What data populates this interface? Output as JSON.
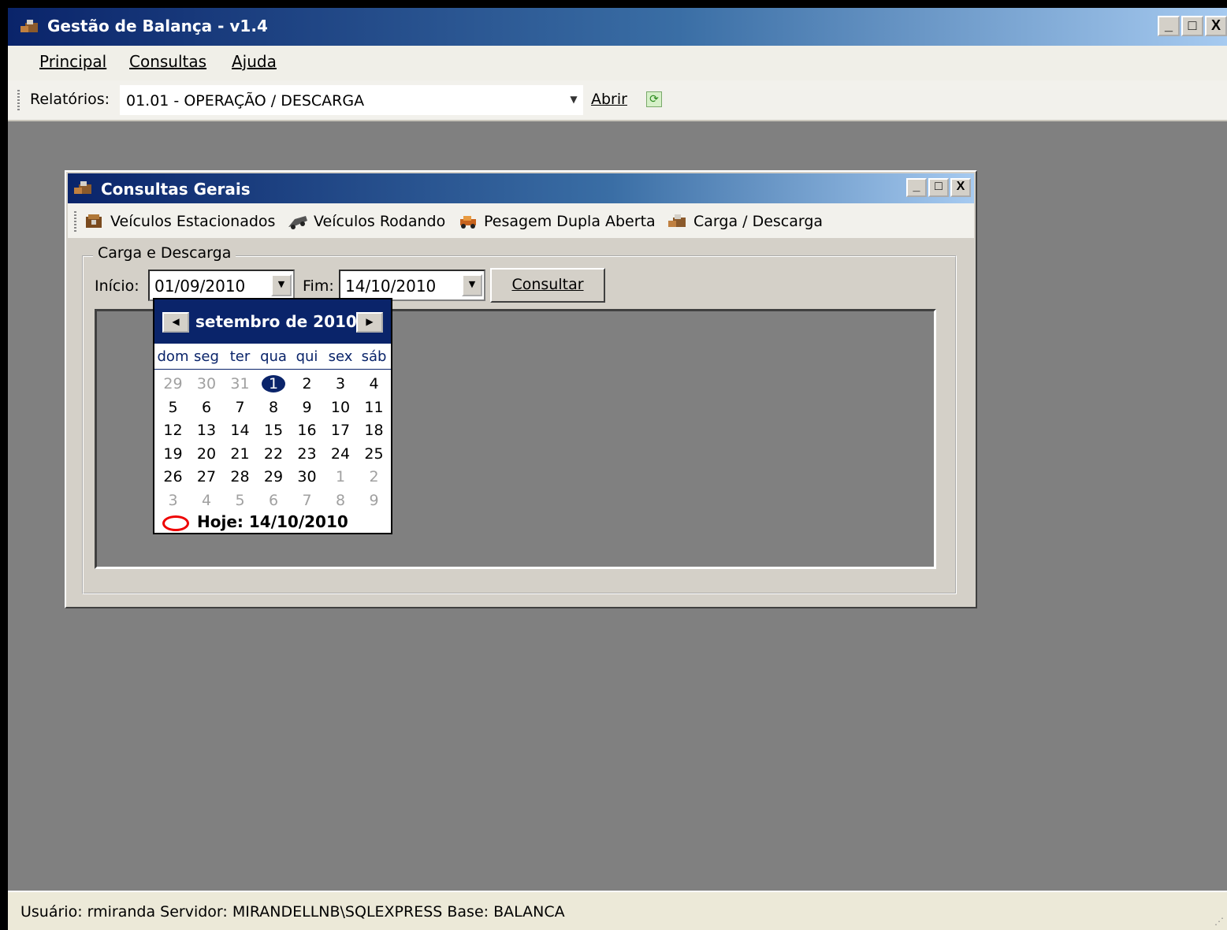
{
  "window": {
    "title": "Gestão de Balança - v1.4",
    "controls": {
      "minimize": "_",
      "maximize": "□",
      "close": "X"
    }
  },
  "menu": {
    "items": [
      {
        "label": "Principal"
      },
      {
        "label": "Consultas"
      },
      {
        "label": "Ajuda"
      }
    ]
  },
  "toolbar": {
    "reports_label": "Relatórios:",
    "report_selected": "01.01 - OPERAÇÃO / DESCARGA",
    "open_label": "Abrir",
    "refresh_icon": "refresh-icon"
  },
  "child_window": {
    "title": "Consultas Gerais",
    "controls": {
      "minimize": "_",
      "maximize": "□",
      "close": "X"
    },
    "toolbar_items": [
      {
        "label": "Veículos Estacionados",
        "icon": "parked-vehicles-icon"
      },
      {
        "label": "Veículos Rodando",
        "icon": "running-vehicles-icon"
      },
      {
        "label": "Pesagem Dupla Aberta",
        "icon": "double-weighing-icon"
      },
      {
        "label": "Carga / Descarga",
        "icon": "load-unload-icon"
      }
    ]
  },
  "filter": {
    "group_title": "Carga e Descarga",
    "start_label": "Início:",
    "start_value": "01/09/2010",
    "end_label": "Fim:",
    "end_value": "14/10/2010",
    "query_button": "Consultar"
  },
  "calendar": {
    "month_label": "setembro de 2010",
    "weekdays": [
      "dom",
      "seg",
      "ter",
      "qua",
      "qui",
      "sex",
      "sáb"
    ],
    "weeks": [
      [
        "29",
        "30",
        "31",
        "1",
        "2",
        "3",
        "4"
      ],
      [
        "5",
        "6",
        "7",
        "8",
        "9",
        "10",
        "11"
      ],
      [
        "12",
        "13",
        "14",
        "15",
        "16",
        "17",
        "18"
      ],
      [
        "19",
        "20",
        "21",
        "22",
        "23",
        "24",
        "25"
      ],
      [
        "26",
        "27",
        "28",
        "29",
        "30",
        "1",
        "2"
      ],
      [
        "3",
        "4",
        "5",
        "6",
        "7",
        "8",
        "9"
      ]
    ],
    "selected_day": "1",
    "today_label": "Hoje: 14/10/2010",
    "colors": {
      "header": "#0a246a",
      "other_month": "#a0a0a0",
      "today_ring": "#e00000"
    }
  },
  "status": {
    "text": "Usuário: rmiranda  Servidor: MIRANDELLNB\\SQLEXPRESS  Base: BALANCA"
  }
}
